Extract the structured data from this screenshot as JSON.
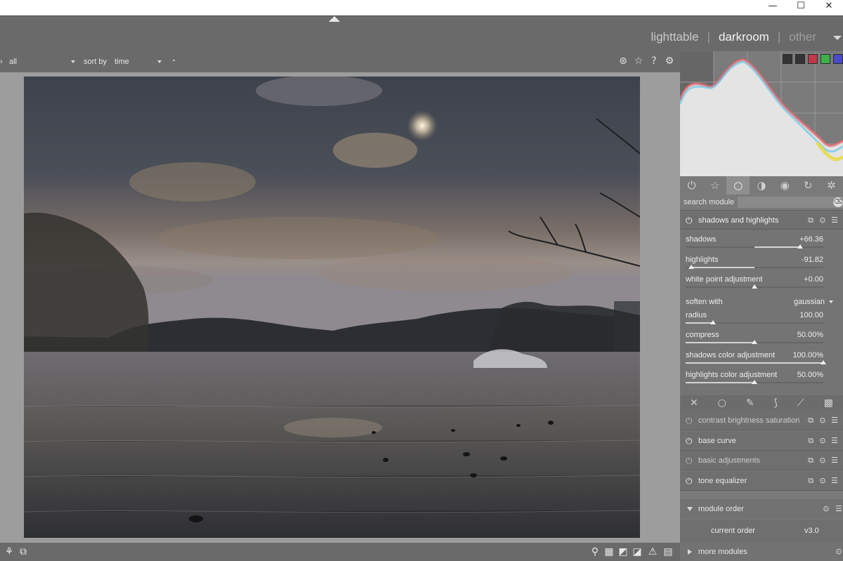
{
  "window": {
    "minimize": "—",
    "maximize": "☐",
    "close": "✕"
  },
  "views": {
    "lighttable": "lighttable",
    "darkroom": "darkroom",
    "other": "other",
    "separator": "|"
  },
  "filterbar": {
    "collection_value": "all",
    "sort_label": "sort by",
    "sort_value": "time",
    "sort_order_glyph": "⬝",
    "icons": [
      "grouping-icon",
      "star-icon",
      "help-icon",
      "gear-icon"
    ]
  },
  "histogram": {
    "colors": [
      "#2a2a2a",
      "#2a2a2a",
      "#c0394a",
      "#3bb34a",
      "#4b4bc8"
    ]
  },
  "module_groups": {
    "icons": [
      "power",
      "favorites",
      "base",
      "tone",
      "color",
      "correct",
      "effect"
    ],
    "active": "base"
  },
  "search": {
    "label": "search module",
    "value": "",
    "clear": "⌫"
  },
  "expanded_module": {
    "title": "shadows and highlights",
    "sliders": [
      {
        "label": "shadows",
        "value": "+66.36",
        "fraction": 0.83,
        "center": 0.5
      },
      {
        "label": "highlights",
        "value": "-91.82",
        "fraction": 0.04,
        "center": 0.5
      },
      {
        "label": "white point adjustment",
        "value": "+0.00",
        "fraction": 0.5,
        "center": 0.5
      }
    ],
    "combo": {
      "label": "soften with",
      "value": "gaussian"
    },
    "sliders2": [
      {
        "label": "radius",
        "value": "100.00",
        "fraction": 0.2,
        "center": 0
      },
      {
        "label": "compress",
        "value": "50.00%",
        "fraction": 0.5,
        "center": 0
      },
      {
        "label": "shadows color adjustment",
        "value": "100.00%",
        "fraction": 1.0,
        "center": 0
      },
      {
        "label": "highlights color adjustment",
        "value": "50.00%",
        "fraction": 0.5,
        "center": 0
      }
    ]
  },
  "masks": {
    "icons": [
      "off",
      "uniform",
      "drawn",
      "parametric",
      "drawn-parametric",
      "raster"
    ]
  },
  "modules": [
    {
      "title": "contrast brightness saturation",
      "enabled": false
    },
    {
      "title": "base curve",
      "enabled": true
    },
    {
      "title": "basic adjustments",
      "enabled": false
    },
    {
      "title": "tone equalizer",
      "enabled": true
    }
  ],
  "module_order": {
    "title": "module order",
    "current_label": "current order",
    "current_value": "v3.0"
  },
  "more_modules": {
    "title": "more modules"
  }
}
